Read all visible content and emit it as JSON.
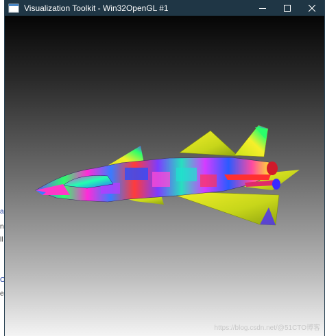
{
  "window": {
    "title": "Visualization Toolkit - Win32OpenGL #1",
    "controls": {
      "minimize": "minimize-icon",
      "maximize": "maximize-icon",
      "close": "close-icon"
    }
  },
  "viewport": {
    "scene": "rainbow-colored 3D fighter jet render",
    "background": {
      "top_color": "#050505",
      "bottom_color": "#f4f4f4"
    }
  },
  "watermark": {
    "text": "https://blog.csdn.net/@51CTO博客"
  },
  "background_page": {
    "marks": [
      "a",
      "n",
      "ll",
      "O",
      "es"
    ]
  },
  "colors": {
    "titlebar": "#1f3645",
    "title_text": "#ffffff"
  }
}
